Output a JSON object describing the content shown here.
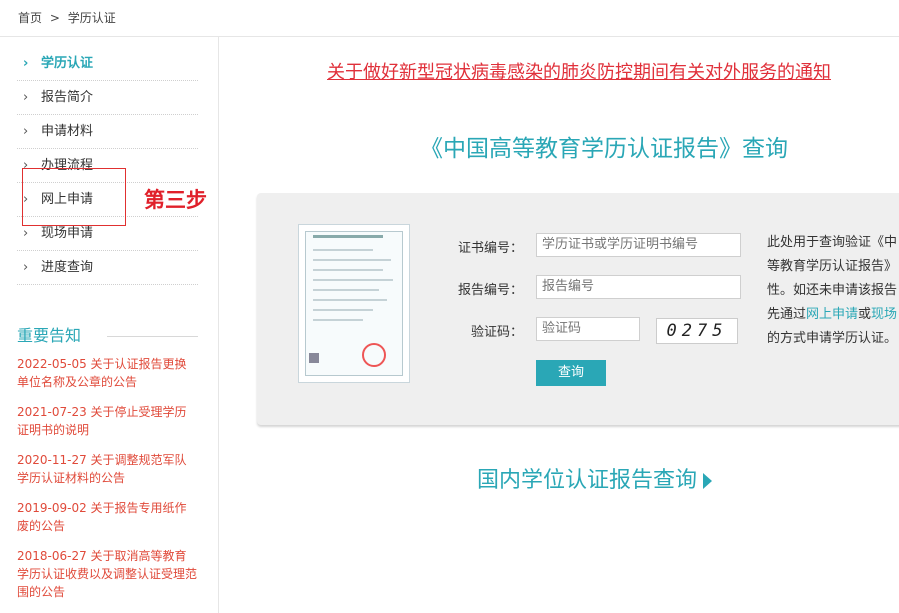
{
  "breadcrumb": {
    "home": "首页",
    "sep": ">",
    "current": "学历认证"
  },
  "sidebar": {
    "items": [
      {
        "label": "学历认证"
      },
      {
        "label": "报告简介"
      },
      {
        "label": "申请材料"
      },
      {
        "label": "办理流程"
      },
      {
        "label": "网上申请"
      },
      {
        "label": "现场申请"
      },
      {
        "label": "进度查询"
      }
    ]
  },
  "annotation": {
    "step_label": "第三步"
  },
  "notices": {
    "title": "重要告知",
    "items": [
      {
        "text": "2022-05-05 关于认证报告更换单位名称及公章的公告"
      },
      {
        "text": "2021-07-23 关于停止受理学历证明书的说明"
      },
      {
        "text": "2020-11-27 关于调整规范军队学历认证材料的公告"
      },
      {
        "text": "2019-09-02 关于报告专用纸作废的公告"
      },
      {
        "text": "2018-06-27 关于取消高等教育学历认证收费以及调整认证受理范围的公告"
      }
    ]
  },
  "main": {
    "announcement": "关于做好新型冠状病毒感染的肺炎防控期间有关对外服务的通知",
    "query_title": "《中国高等教育学历认证报告》查询",
    "form": {
      "cert_label": "证书编号：",
      "cert_placeholder": "学历证书或学历证明书编号",
      "report_label": "报告编号：",
      "report_placeholder": "报告编号",
      "captcha_label": "验证码：",
      "captcha_placeholder": "验证码",
      "captcha_text": "0275",
      "submit_label": "查询"
    },
    "description": {
      "line1": "此处用于查询验证《中",
      "line2": "等教育学历认证报告》",
      "line3": "性。如还未申请该报告",
      "line4_pre": "先通过",
      "link_online": "网上申请",
      "line4_mid": "或",
      "link_onsite": "现场",
      "line5": "的方式申请学历认证。"
    },
    "degree_link": "国内学位认证报告查询"
  },
  "colors": {
    "accent": "#2aa7b6",
    "alert": "#e0303a"
  }
}
